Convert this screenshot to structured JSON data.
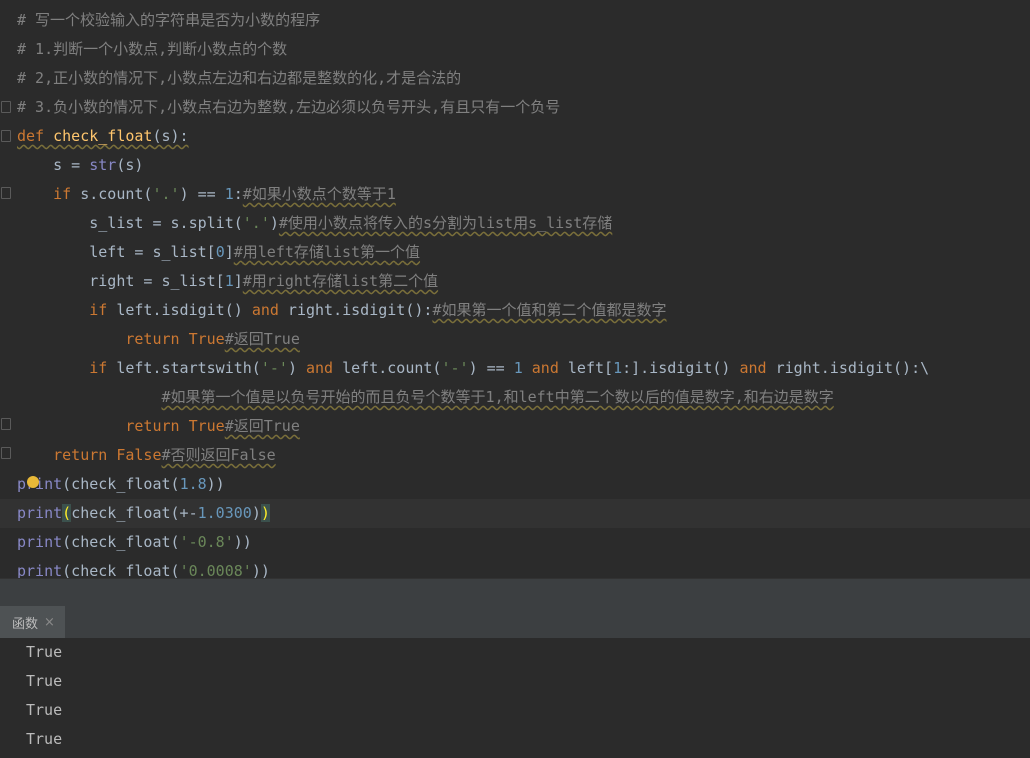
{
  "editor": {
    "lines": [
      "# 写一个校验输入的字符串是否为小数的程序",
      "# 1.判断一个小数点,判断小数点的个数",
      "# 2,正小数的情况下,小数点左边和右边都是整数的化,才是合法的",
      "# 3.负小数的情况下,小数点右边为整数,左边必须以负号开头,有且只有一个负号"
    ],
    "code": {
      "def_kw": "def",
      "def_name": "check_float",
      "def_rest": "(s):",
      "l6_a": "    s = ",
      "l6_b": "str",
      "l6_c": "(s)",
      "l7_if": "    if",
      "l7_a": " s.count(",
      "l7_str": "'.'",
      "l7_b": ") == ",
      "l7_num": "1",
      "l7_c": ":",
      "l7_cm": "#如果小数点个数等于1",
      "l8_a": "        s_list = s.split(",
      "l8_str": "'.'",
      "l8_b": ")",
      "l8_cm": "#使用小数点将传入的s分割为list用s_list存储",
      "l9_a": "        left = s_list[",
      "l9_num": "0",
      "l9_b": "]",
      "l9_cm": "#用left存储list第一个值",
      "l10_a": "        right = s_list[",
      "l10_num": "1",
      "l10_b": "]",
      "l10_cm": "#用right存储list第二个值",
      "l11_if": "        if",
      "l11_a": " left.isdigit() ",
      "l11_and": "and",
      "l11_b": " right.isdigit():",
      "l11_cm": "#如果第一个值和第二个值都是数字",
      "l12_ret": "            return",
      "l12_true": " True",
      "l12_cm": "#返回True",
      "l13_if": "        if",
      "l13_a": " left.startswith(",
      "l13_str1": "'-'",
      "l13_b": ") ",
      "l13_and1": "and",
      "l13_c": " left.count(",
      "l13_str2": "'-'",
      "l13_d": ") == ",
      "l13_num": "1",
      "l13_e": " ",
      "l13_and2": "and",
      "l13_f": " left[",
      "l13_num2": "1",
      "l13_g": ":].isdigit() ",
      "l13_and3": "and",
      "l13_h": " right.isdigit():\\",
      "l14_pad": "                ",
      "l14_cm": "#如果第一个值是以负号开始的而且负号个数等于1,和left中第二个数以后的值是数字,和右边是数字",
      "l15_ret": "            return",
      "l15_true": " True",
      "l15_cm": "#返回True",
      "l16_ret": "    return",
      "l16_false": " False",
      "l16_cm": "#否则返回False",
      "l17_a": "print",
      "l17_b": "(check_float(",
      "l17_num": "1.8",
      "l17_c": "))",
      "l18_a": "print",
      "l18_paren": "(",
      "l18_b": "check_float(+-",
      "l18_num": "1.0300",
      "l18_c": ")",
      "l18_paren2": ")",
      "l19_a": "print",
      "l19_b": "(check_float(",
      "l19_str": "'-0.8'",
      "l19_c": "))",
      "l20_a": "print",
      "l20_b": "(check_float(",
      "l20_str": "'0.0008'",
      "l20_c": "))"
    }
  },
  "run_panel": {
    "tab_label": "函数",
    "close_icon": "×",
    "outputs": [
      "True",
      "True",
      "True",
      "True"
    ]
  },
  "colors": {
    "background": "#2b2b2b",
    "keyword": "#cc7832",
    "string": "#6a8759",
    "number": "#6897bb",
    "comment": "#808080",
    "function_def": "#ffc66d"
  }
}
